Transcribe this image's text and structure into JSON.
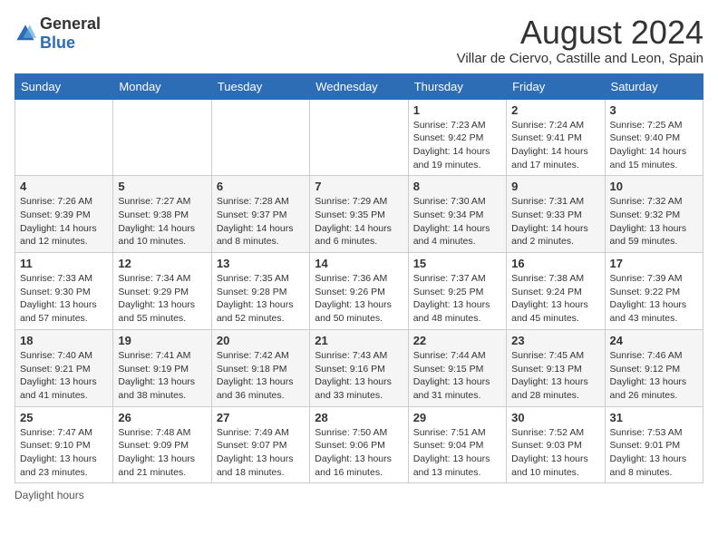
{
  "header": {
    "logo_general": "General",
    "logo_blue": "Blue",
    "main_title": "August 2024",
    "subtitle": "Villar de Ciervo, Castille and Leon, Spain"
  },
  "calendar": {
    "days_of_week": [
      "Sunday",
      "Monday",
      "Tuesday",
      "Wednesday",
      "Thursday",
      "Friday",
      "Saturday"
    ],
    "weeks": [
      [
        {
          "day": "",
          "sunrise": "",
          "sunset": "",
          "daylight": ""
        },
        {
          "day": "",
          "sunrise": "",
          "sunset": "",
          "daylight": ""
        },
        {
          "day": "",
          "sunrise": "",
          "sunset": "",
          "daylight": ""
        },
        {
          "day": "",
          "sunrise": "",
          "sunset": "",
          "daylight": ""
        },
        {
          "day": "1",
          "sunrise": "Sunrise: 7:23 AM",
          "sunset": "Sunset: 9:42 PM",
          "daylight": "Daylight: 14 hours and 19 minutes."
        },
        {
          "day": "2",
          "sunrise": "Sunrise: 7:24 AM",
          "sunset": "Sunset: 9:41 PM",
          "daylight": "Daylight: 14 hours and 17 minutes."
        },
        {
          "day": "3",
          "sunrise": "Sunrise: 7:25 AM",
          "sunset": "Sunset: 9:40 PM",
          "daylight": "Daylight: 14 hours and 15 minutes."
        }
      ],
      [
        {
          "day": "4",
          "sunrise": "Sunrise: 7:26 AM",
          "sunset": "Sunset: 9:39 PM",
          "daylight": "Daylight: 14 hours and 12 minutes."
        },
        {
          "day": "5",
          "sunrise": "Sunrise: 7:27 AM",
          "sunset": "Sunset: 9:38 PM",
          "daylight": "Daylight: 14 hours and 10 minutes."
        },
        {
          "day": "6",
          "sunrise": "Sunrise: 7:28 AM",
          "sunset": "Sunset: 9:37 PM",
          "daylight": "Daylight: 14 hours and 8 minutes."
        },
        {
          "day": "7",
          "sunrise": "Sunrise: 7:29 AM",
          "sunset": "Sunset: 9:35 PM",
          "daylight": "Daylight: 14 hours and 6 minutes."
        },
        {
          "day": "8",
          "sunrise": "Sunrise: 7:30 AM",
          "sunset": "Sunset: 9:34 PM",
          "daylight": "Daylight: 14 hours and 4 minutes."
        },
        {
          "day": "9",
          "sunrise": "Sunrise: 7:31 AM",
          "sunset": "Sunset: 9:33 PM",
          "daylight": "Daylight: 14 hours and 2 minutes."
        },
        {
          "day": "10",
          "sunrise": "Sunrise: 7:32 AM",
          "sunset": "Sunset: 9:32 PM",
          "daylight": "Daylight: 13 hours and 59 minutes."
        }
      ],
      [
        {
          "day": "11",
          "sunrise": "Sunrise: 7:33 AM",
          "sunset": "Sunset: 9:30 PM",
          "daylight": "Daylight: 13 hours and 57 minutes."
        },
        {
          "day": "12",
          "sunrise": "Sunrise: 7:34 AM",
          "sunset": "Sunset: 9:29 PM",
          "daylight": "Daylight: 13 hours and 55 minutes."
        },
        {
          "day": "13",
          "sunrise": "Sunrise: 7:35 AM",
          "sunset": "Sunset: 9:28 PM",
          "daylight": "Daylight: 13 hours and 52 minutes."
        },
        {
          "day": "14",
          "sunrise": "Sunrise: 7:36 AM",
          "sunset": "Sunset: 9:26 PM",
          "daylight": "Daylight: 13 hours and 50 minutes."
        },
        {
          "day": "15",
          "sunrise": "Sunrise: 7:37 AM",
          "sunset": "Sunset: 9:25 PM",
          "daylight": "Daylight: 13 hours and 48 minutes."
        },
        {
          "day": "16",
          "sunrise": "Sunrise: 7:38 AM",
          "sunset": "Sunset: 9:24 PM",
          "daylight": "Daylight: 13 hours and 45 minutes."
        },
        {
          "day": "17",
          "sunrise": "Sunrise: 7:39 AM",
          "sunset": "Sunset: 9:22 PM",
          "daylight": "Daylight: 13 hours and 43 minutes."
        }
      ],
      [
        {
          "day": "18",
          "sunrise": "Sunrise: 7:40 AM",
          "sunset": "Sunset: 9:21 PM",
          "daylight": "Daylight: 13 hours and 41 minutes."
        },
        {
          "day": "19",
          "sunrise": "Sunrise: 7:41 AM",
          "sunset": "Sunset: 9:19 PM",
          "daylight": "Daylight: 13 hours and 38 minutes."
        },
        {
          "day": "20",
          "sunrise": "Sunrise: 7:42 AM",
          "sunset": "Sunset: 9:18 PM",
          "daylight": "Daylight: 13 hours and 36 minutes."
        },
        {
          "day": "21",
          "sunrise": "Sunrise: 7:43 AM",
          "sunset": "Sunset: 9:16 PM",
          "daylight": "Daylight: 13 hours and 33 minutes."
        },
        {
          "day": "22",
          "sunrise": "Sunrise: 7:44 AM",
          "sunset": "Sunset: 9:15 PM",
          "daylight": "Daylight: 13 hours and 31 minutes."
        },
        {
          "day": "23",
          "sunrise": "Sunrise: 7:45 AM",
          "sunset": "Sunset: 9:13 PM",
          "daylight": "Daylight: 13 hours and 28 minutes."
        },
        {
          "day": "24",
          "sunrise": "Sunrise: 7:46 AM",
          "sunset": "Sunset: 9:12 PM",
          "daylight": "Daylight: 13 hours and 26 minutes."
        }
      ],
      [
        {
          "day": "25",
          "sunrise": "Sunrise: 7:47 AM",
          "sunset": "Sunset: 9:10 PM",
          "daylight": "Daylight: 13 hours and 23 minutes."
        },
        {
          "day": "26",
          "sunrise": "Sunrise: 7:48 AM",
          "sunset": "Sunset: 9:09 PM",
          "daylight": "Daylight: 13 hours and 21 minutes."
        },
        {
          "day": "27",
          "sunrise": "Sunrise: 7:49 AM",
          "sunset": "Sunset: 9:07 PM",
          "daylight": "Daylight: 13 hours and 18 minutes."
        },
        {
          "day": "28",
          "sunrise": "Sunrise: 7:50 AM",
          "sunset": "Sunset: 9:06 PM",
          "daylight": "Daylight: 13 hours and 16 minutes."
        },
        {
          "day": "29",
          "sunrise": "Sunrise: 7:51 AM",
          "sunset": "Sunset: 9:04 PM",
          "daylight": "Daylight: 13 hours and 13 minutes."
        },
        {
          "day": "30",
          "sunrise": "Sunrise: 7:52 AM",
          "sunset": "Sunset: 9:03 PM",
          "daylight": "Daylight: 13 hours and 10 minutes."
        },
        {
          "day": "31",
          "sunrise": "Sunrise: 7:53 AM",
          "sunset": "Sunset: 9:01 PM",
          "daylight": "Daylight: 13 hours and 8 minutes."
        }
      ]
    ]
  },
  "footer": {
    "note": "Daylight hours"
  }
}
